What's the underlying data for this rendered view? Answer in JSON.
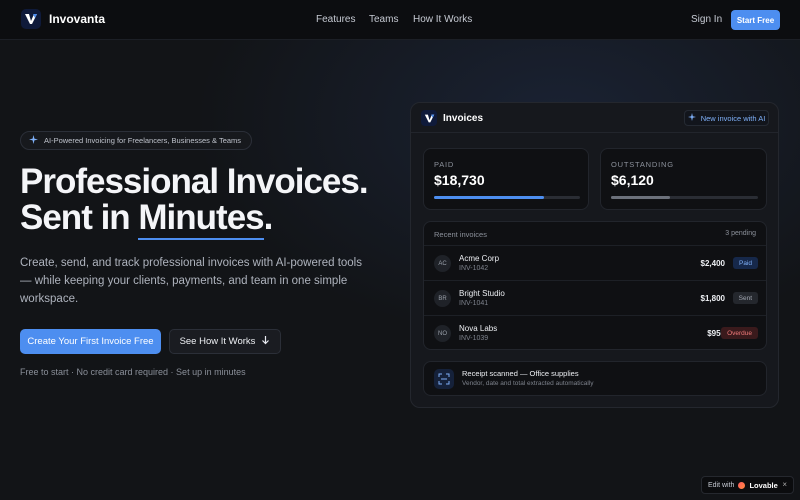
{
  "nav": {
    "brand": "Invovanta",
    "links": [
      "Features",
      "Teams",
      "How It Works"
    ],
    "sign_in": "Sign In",
    "start_free": "Start Free"
  },
  "hero": {
    "pill": "AI-Powered Invoicing for Freelancers, Businesses & Teams",
    "title_line1": "Professional Invoices.",
    "title_line2_a": "Sent in ",
    "title_line2_b": "Minutes",
    "title_line2_c": ".",
    "subtitle": "Create, send, and track professional invoices with AI-powered tools — while keeping your clients, payments, and team in one simple workspace.",
    "cta_primary": "Create Your First Invoice Free",
    "cta_secondary": "See How It Works",
    "note": "Free to start · No credit card required · Set up in minutes"
  },
  "card": {
    "title": "Invoices",
    "ai_button": "New invoice with AI",
    "stats": [
      {
        "label": "PAID",
        "value": "$18,730",
        "progress": 0.75,
        "color": "#4d8ef0"
      },
      {
        "label": "OUTSTANDING",
        "value": "$6,120",
        "progress": 0.4,
        "color": "#6c717b"
      }
    ],
    "recent_title": "Recent invoices",
    "recent_count": "3 pending",
    "rows": [
      {
        "initials": "AC",
        "client": "Acme Corp",
        "invoice": "INV-1042",
        "amount": "$2,400",
        "status": "Paid",
        "status_bg": "#16284a",
        "status_fg": "#7fb0f8"
      },
      {
        "initials": "BR",
        "client": "Bright Studio",
        "invoice": "INV-1041",
        "amount": "$1,800",
        "status": "Sent",
        "status_bg": "#24272d",
        "status_fg": "#a2a7b1"
      },
      {
        "initials": "NO",
        "client": "Nova Labs",
        "invoice": "INV-1039",
        "amount": "$950",
        "status": "Overdue",
        "status_bg": "#3a1a1c",
        "status_fg": "#f07a7a"
      }
    ],
    "receipt_title": "Receipt scanned — Office supplies",
    "receipt_sub": "Vendor, date and total extracted automatically"
  },
  "edit_badge": {
    "label": "Edit with",
    "brand": "Lovable",
    "close": "×"
  },
  "colors": {
    "accent": "#4d8ef0",
    "background": "#121417"
  }
}
